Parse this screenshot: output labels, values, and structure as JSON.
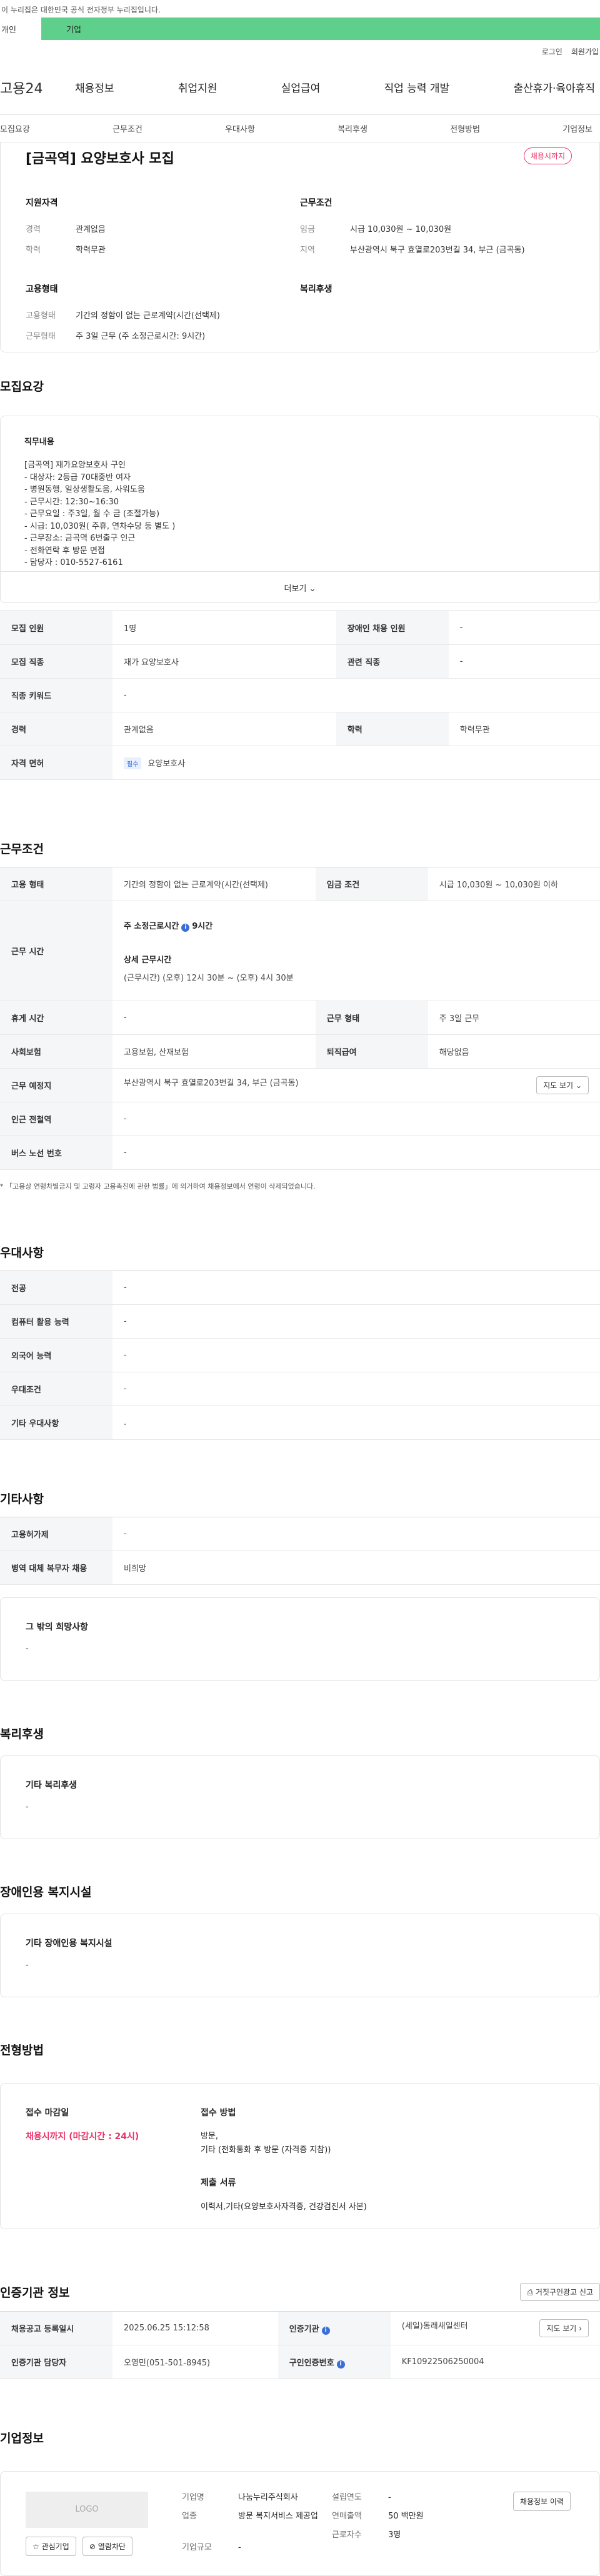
{
  "topbar": {
    "notice": "이 누리집은 대한민국 공식 전자정부 누리집입니다."
  },
  "tabs": {
    "personal": "개인",
    "corporate": "기업"
  },
  "util": {
    "login": "로그인",
    "signup": "회원가입"
  },
  "gnb": {
    "logo": "고용24",
    "menu": [
      "채용정보",
      "취업지원",
      "실업급여",
      "직업 능력 개발",
      "출산휴가·육아휴직"
    ]
  },
  "subnav": [
    "모집요강",
    "근무조건",
    "우대사항",
    "복리후생",
    "전형방법",
    "기업정보"
  ],
  "summary": {
    "title": "[금곡역] 요양보호사 모집",
    "badge": "채용시까지",
    "qual_title": "지원자격",
    "qual": [
      {
        "k": "경력",
        "v": "관계없음"
      },
      {
        "k": "학력",
        "v": "학력무관"
      }
    ],
    "cond_title": "근무조건",
    "cond": [
      {
        "k": "임금",
        "v": "시급 10,030원 ~ 10,030원"
      },
      {
        "k": "지역",
        "v": "부산광역시 북구 효열로203번길 34, 부근 (금곡동)"
      }
    ],
    "emp_title": "고용형태",
    "emp": [
      {
        "k": "고용형태",
        "v": "기간의 정함이 없는 근로계약(시간(선택제)"
      },
      {
        "k": "근무형태",
        "v": "주 3일 근무 (주 소정근로시간: 9시간)"
      }
    ],
    "welfare_title": "복리후생"
  },
  "recruit": {
    "title": "모집요강",
    "duty_title": "직무내용",
    "duty_lines": [
      "[금곡역] 재가요양보호사 구인",
      "- 대상자: 2등급 70대중반 여자",
      "- 병원동행, 일상생활도움, 사워도움",
      "- 근무시간: 12:30~16:30",
      "- 근무요일 : 주3일, 월 수 금 (조절가능)",
      "- 시급: 10,030원( 주휴, 연차수당 등 별도 )",
      "- 근무장소: 금곡역 6번출구 인근",
      "- 전화연락 후 방문 면접",
      "- 담당자 : 010-5527-6161"
    ],
    "more": "더보기",
    "table": {
      "headcount_h": "모집 인원",
      "headcount": "1명",
      "disabled_h": "장애인 채용 인원",
      "disabled": "-",
      "job_h": "모집 직종",
      "job": "재가 요양보호사",
      "related_h": "관련 직종",
      "related": "-",
      "keyword_h": "직종 키워드",
      "keyword": "-",
      "career_h": "경력",
      "career": "관계없음",
      "edu_h": "학력",
      "edu": "학력무관",
      "license_h": "자격 면허",
      "license_tag": "필수",
      "license": "요양보호사"
    }
  },
  "work": {
    "title": "근무조건",
    "type_h": "고용 형태",
    "type": "기간의 정함이 없는 근로계약(시간(선택제)",
    "wage_h": "임금 조건",
    "wage": "시급 10,030원 ~ 10,030원 이하",
    "time_h": "근무 시간",
    "hours_label": "주 소정근로시간",
    "hours": "9시간",
    "detail_label": "상세 근무시간",
    "detail": "(근무시간) (오후) 12시 30분 ~ (오후) 4시 30분",
    "rest_h": "휴게 시간",
    "rest": "-",
    "shape_h": "근무 형태",
    "shape": "주 3일 근무",
    "insurance_h": "사회보험",
    "insurance": "고용보험, 산재보험",
    "retire_h": "퇴직급여",
    "retire": "해당없음",
    "place_h": "근무 예정지",
    "place": "부산광역시 북구 효열로203번길 34, 부근 (금곡동)",
    "map_btn": "지도 보기",
    "subway_h": "인근 전철역",
    "subway": "-",
    "bus_h": "버스 노선 번호",
    "bus": "-",
    "note": "* 「고용상 연령차별금지 및 고령자 고용촉진에 관한 법률」에 의거하여 채용정보에서 연령이 삭제되었습니다."
  },
  "pref": {
    "title": "우대사항",
    "rows": [
      {
        "h": "전공",
        "v": "-"
      },
      {
        "h": "컴퓨터 활용 능력",
        "v": "-"
      },
      {
        "h": "외국어 능력",
        "v": "-"
      },
      {
        "h": "우대조건",
        "v": "-"
      },
      {
        "h": "기타 우대사항",
        "v": "."
      }
    ]
  },
  "etc": {
    "title": "기타사항",
    "rows": [
      {
        "h": "고용허가제",
        "v": "-"
      },
      {
        "h": "병역 대체 복무자 채용",
        "v": "비희망"
      }
    ],
    "other_title": "그 밖의 희망사항",
    "other": "-"
  },
  "welfare": {
    "title": "복리후생",
    "box_title": "기타 복리후생",
    "box": "-"
  },
  "disabled": {
    "title": "장애인용 복지시설",
    "box_title": "기타 장애인용 복지시설",
    "box": "-"
  },
  "process": {
    "title": "전형방법",
    "deadline_title": "접수 마감일",
    "deadline": "채용시까지 (마감시간 : 24시)",
    "method_title": "접수 방법",
    "method_lines": [
      "방문,",
      "기타 (전화통화 후 방문 (자격증 지참))"
    ],
    "docs_title": "제출 서류",
    "docs": "이력서,기타(요양보호사자격증, 건강검진서 사본)"
  },
  "agency": {
    "title": "인증기관 정보",
    "report_btn": "거짓구인광고 신고",
    "reg_h": "채용공고 등록일시",
    "reg": "2025.06.25 15:12:58",
    "org_h": "인증기관",
    "org": "(세일)동래새일센터",
    "map_btn": "지도 보기",
    "mgr_h": "인증기관 담당자",
    "mgr": "오영민(051-501-8945)",
    "no_h": "구인인증번호",
    "no": "KF10922506250004"
  },
  "company": {
    "title": "기업정보",
    "logo": "LOGO",
    "interest_btn": "관심기업",
    "block_btn": "열람차단",
    "history_btn": "채용정보 이력",
    "rows1": [
      {
        "k": "기업명",
        "v": "나눔누리주식회사"
      },
      {
        "k": "업종",
        "v": "방문 복지서비스 제공업"
      },
      {
        "k": "기업규모",
        "v": "-"
      }
    ],
    "rows2": [
      {
        "k": "설립연도",
        "v": "-"
      },
      {
        "k": "연매출액",
        "v": "50 백만원"
      },
      {
        "k": "근로자수",
        "v": "3명"
      }
    ]
  }
}
